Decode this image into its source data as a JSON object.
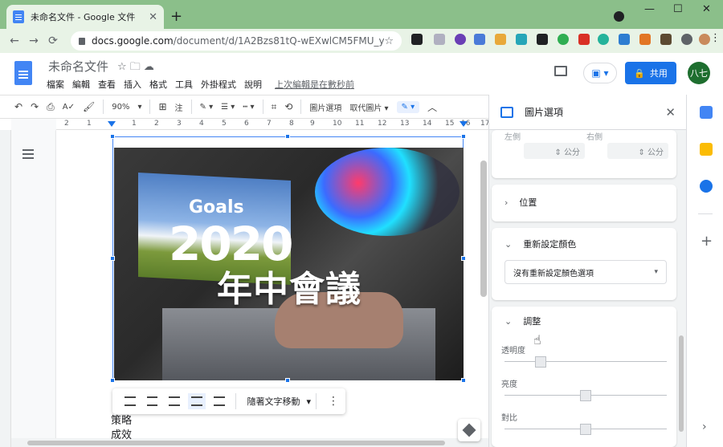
{
  "browser": {
    "tab_title": "未命名文件 - Google 文件",
    "tab_close": "✕",
    "new_tab": "+",
    "url_host": "docs.google.com",
    "url_path": "/document/d/1A2Bzs81tQ-wEXwlCM5FMU_yy...",
    "star": "☆",
    "back": "←",
    "forward": "→",
    "reload": "⟳",
    "minimize": "—",
    "maximize": "☐",
    "close": "✕",
    "menu": "⋮"
  },
  "docs": {
    "doc_title": "未命名文件",
    "title_icons": "☆ 🗀 ☁",
    "menus": [
      "檔案",
      "編輯",
      "查看",
      "插入",
      "格式",
      "工具",
      "外掛程式",
      "說明"
    ],
    "last_edit": "上次編輯是在數秒前",
    "present_label": "▣ ▾",
    "share_icon": "🔒",
    "share_label": "共用",
    "avatar_text": "八七"
  },
  "format_toolbar": {
    "undo": "↶",
    "redo": "↷",
    "print": "⎙",
    "spell": "A✓",
    "paint": "🖌",
    "zoom": "90%",
    "zoom_arrow": "▾",
    "comment": "⊞",
    "comment_label": "注",
    "pen": "✎ ▾",
    "line_weight": "☰ ▾",
    "line_dash": "┅ ▾",
    "crop": "⌗",
    "reset_image": "⟲",
    "image_options": "圖片選項",
    "replace_image": "取代圖片 ▾",
    "edit_mode": "✎ ▾",
    "collapse": "︿"
  },
  "ruler": {
    "ticks": [
      "2",
      "1",
      "1",
      "2",
      "3",
      "4",
      "5",
      "6",
      "7",
      "8",
      "9",
      "10",
      "11",
      "12",
      "13",
      "14",
      "15",
      "16",
      "17"
    ]
  },
  "image": {
    "goals": "Goals",
    "year": "2020",
    "headline": "年中會議"
  },
  "image_toolbar": {
    "move_with_text": "隨著文字移動",
    "move_arrow": "▾",
    "more": "⋮"
  },
  "body": {
    "line1": "策略",
    "line2": "成效"
  },
  "panel": {
    "title": "圖片選項",
    "close": "✕",
    "left_label": "左側",
    "right_label": "右側",
    "unit_left": "⇕ 公分",
    "unit_right": "⇕ 公分",
    "position_label": "位置",
    "recolor_label": "重新設定顏色",
    "recolor_option": "沒有重新設定顏色選項",
    "recolor_arrow": "▾",
    "adjust_label": "調整",
    "transparency": "透明度",
    "brightness": "亮度",
    "contrast": "對比",
    "chevron_right": "›",
    "chevron_down": "⌄",
    "transparency_value": 0,
    "brightness_value": 0.5,
    "contrast_value": 0.5
  },
  "rail": {
    "plus": "+",
    "expand": "›"
  },
  "colors": {
    "chrome_green": "#8bbf8a",
    "accent": "#1a73e8",
    "avatar": "#1e6e2f"
  }
}
